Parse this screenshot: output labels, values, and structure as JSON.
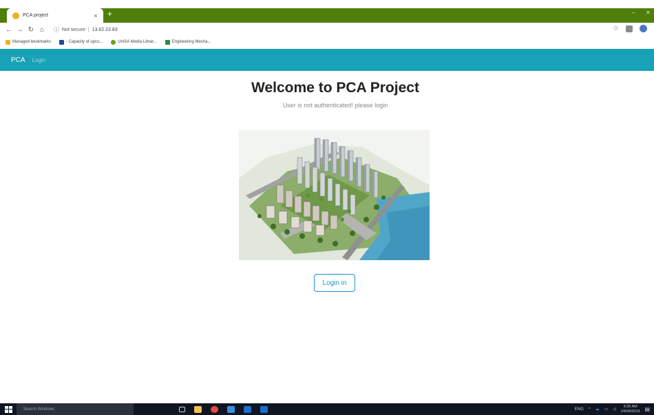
{
  "browser": {
    "tab_title": "PCA project",
    "tab_close": "×",
    "new_tab": "+",
    "address": {
      "security_text": "Not secure",
      "separator": "|",
      "url": "13.62.23.83"
    },
    "bookmarks": [
      {
        "label": "Managed bookmarks",
        "color": "#f0b020"
      },
      {
        "label": "- Capacity of upco...",
        "color": "#234a9c"
      },
      {
        "label": "UniSA Media Librar...",
        "color": "#63a818"
      },
      {
        "label": "Engineering Mecha...",
        "color": "#2d8a4a"
      }
    ]
  },
  "navbar": {
    "brand": "PCA",
    "login_link": "Login"
  },
  "main": {
    "title": "Welcome to PCA Project",
    "subtitle": "User is not authenticated! please login",
    "login_button": "Login in"
  },
  "taskbar": {
    "search_placeholder": "Search Windows",
    "time": "9:35 AM",
    "date": "24/09/2019",
    "tray_text": "ENG"
  },
  "colors": {
    "tab_strip": "#4f7f0a",
    "navbar": "#17a2b8",
    "button_accent": "#1e8fcf",
    "taskbar": "#101423"
  }
}
